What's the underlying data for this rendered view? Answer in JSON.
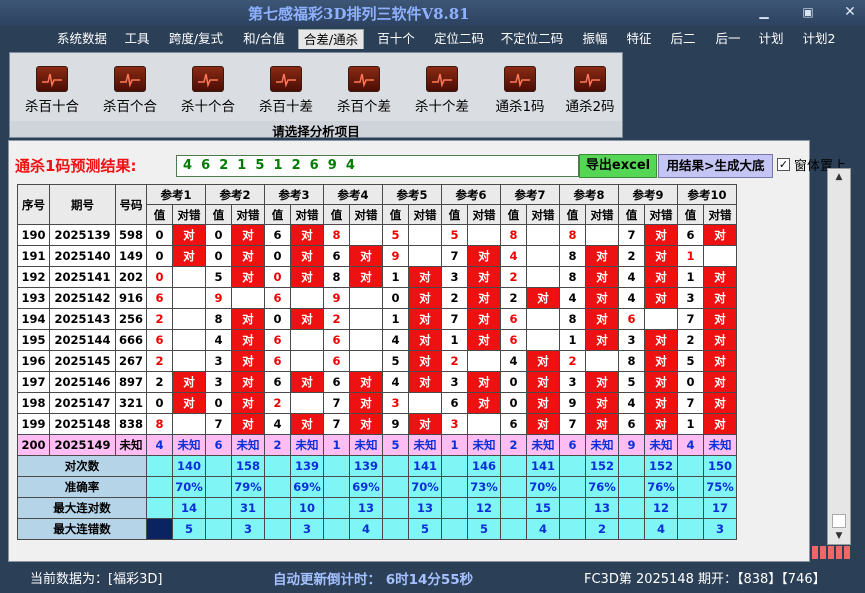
{
  "app": {
    "title": "第七感福彩3D排列三软件V8.81"
  },
  "menu": [
    "系统数据",
    "工具",
    "跨度/复式",
    "和/合值",
    "合差/通杀",
    "百十个",
    "定位二码",
    "不定位二码",
    "振幅",
    "特征",
    "后二",
    "后一",
    "计划",
    "计划2"
  ],
  "ribbon": {
    "items": [
      "杀百十合",
      "杀百个合",
      "杀十个合",
      "杀百十差",
      "杀百个差",
      "杀十个差",
      "通杀1码",
      "通杀2码"
    ],
    "caption": "请选择分析项目"
  },
  "prediction": {
    "label": "通杀1码预测结果:",
    "digits": "4  6  2  1  5  1  2  6  9  4",
    "export_button": "导出excel",
    "dadi_button": "用结果>生成大底",
    "topmost_label": "窗体置上",
    "topmost_checked": "✓"
  },
  "table": {
    "headers": {
      "index": "序号",
      "issue": "期号",
      "number": "号码",
      "value": "值",
      "result": "对错"
    },
    "refs": [
      "参考1",
      "参考2",
      "参考3",
      "参考4",
      "参考5",
      "参考6",
      "参考7",
      "参考8",
      "参考9",
      "参考10"
    ],
    "mark_symbol": "对",
    "rows": [
      {
        "idx": "190",
        "issue": "2025139",
        "num": "598",
        "vals": [
          "0",
          "0",
          "6",
          "8",
          "5",
          "5",
          "8",
          "8",
          "7",
          "6"
        ],
        "hits": [
          1,
          1,
          1,
          0,
          0,
          0,
          0,
          0,
          1,
          1
        ]
      },
      {
        "idx": "191",
        "issue": "2025140",
        "num": "149",
        "vals": [
          "0",
          "0",
          "0",
          "6",
          "9",
          "7",
          "4",
          "8",
          "2",
          "1"
        ],
        "hits": [
          1,
          1,
          1,
          1,
          0,
          1,
          0,
          1,
          1,
          0
        ]
      },
      {
        "idx": "192",
        "issue": "2025141",
        "num": "202",
        "vals": [
          "0",
          "5",
          "0",
          "8",
          "1",
          "3",
          "2",
          "8",
          "4",
          "1"
        ],
        "hits": [
          0,
          1,
          1,
          1,
          1,
          1,
          0,
          1,
          1,
          1
        ]
      },
      {
        "idx": "193",
        "issue": "2025142",
        "num": "916",
        "vals": [
          "6",
          "9",
          "6",
          "9",
          "0",
          "2",
          "2",
          "4",
          "4",
          "3"
        ],
        "hits": [
          0,
          0,
          0,
          0,
          1,
          1,
          1,
          1,
          1,
          1
        ]
      },
      {
        "idx": "194",
        "issue": "2025143",
        "num": "256",
        "vals": [
          "2",
          "8",
          "0",
          "2",
          "1",
          "7",
          "6",
          "8",
          "6",
          "7"
        ],
        "hits": [
          0,
          1,
          1,
          0,
          1,
          1,
          0,
          1,
          0,
          1
        ]
      },
      {
        "idx": "195",
        "issue": "2025144",
        "num": "666",
        "vals": [
          "6",
          "4",
          "6",
          "6",
          "4",
          "1",
          "6",
          "1",
          "3",
          "2"
        ],
        "hits": [
          0,
          1,
          0,
          0,
          1,
          1,
          0,
          1,
          1,
          1
        ]
      },
      {
        "idx": "196",
        "issue": "2025145",
        "num": "267",
        "vals": [
          "2",
          "3",
          "6",
          "6",
          "5",
          "2",
          "4",
          "2",
          "8",
          "5"
        ],
        "hits": [
          0,
          1,
          0,
          0,
          1,
          0,
          1,
          0,
          1,
          1
        ]
      },
      {
        "idx": "197",
        "issue": "2025146",
        "num": "897",
        "vals": [
          "2",
          "3",
          "6",
          "6",
          "4",
          "3",
          "0",
          "3",
          "5",
          "0"
        ],
        "hits": [
          1,
          1,
          1,
          1,
          1,
          1,
          1,
          1,
          1,
          1
        ]
      },
      {
        "idx": "198",
        "issue": "2025147",
        "num": "321",
        "vals": [
          "0",
          "0",
          "2",
          "7",
          "3",
          "6",
          "0",
          "9",
          "4",
          "7"
        ],
        "hits": [
          1,
          1,
          0,
          1,
          0,
          1,
          1,
          1,
          1,
          1
        ]
      },
      {
        "idx": "199",
        "issue": "2025148",
        "num": "838",
        "vals": [
          "8",
          "7",
          "4",
          "7",
          "9",
          "3",
          "6",
          "7",
          "6",
          "1"
        ],
        "hits": [
          0,
          1,
          1,
          1,
          1,
          0,
          1,
          1,
          1,
          1
        ]
      }
    ],
    "current": {
      "idx": "200",
      "issue": "2025149",
      "num": "未知",
      "vals": [
        "4",
        "6",
        "2",
        "1",
        "5",
        "1",
        "2",
        "6",
        "9",
        "4"
      ],
      "result": "未知"
    },
    "stats": [
      {
        "label": "对次数",
        "vals": [
          "140",
          "158",
          "139",
          "139",
          "141",
          "146",
          "141",
          "152",
          "152",
          "150"
        ]
      },
      {
        "label": "准确率",
        "vals": [
          "70%",
          "79%",
          "69%",
          "69%",
          "70%",
          "73%",
          "70%",
          "76%",
          "76%",
          "75%"
        ]
      },
      {
        "label": "最大连对数",
        "vals": [
          "14",
          "31",
          "10",
          "13",
          "13",
          "12",
          "15",
          "13",
          "12",
          "17"
        ]
      },
      {
        "label": "最大连错数",
        "vals": [
          "5",
          "3",
          "3",
          "4",
          "5",
          "5",
          "4",
          "2",
          "4",
          "3"
        ]
      }
    ]
  },
  "status": {
    "current_data": "当前数据为：[福彩3D]",
    "countdown": "自动更新倒计时：  6时14分55秒",
    "issue_info": "FC3D第 2025148 期开：【838】【746】"
  },
  "colors": {
    "hit": "#ee1111",
    "current_row": "#ffbdf3",
    "stats_row": "#7ff5f5",
    "value_blue": "#0a2fd8",
    "title_blue": "#8fb0ff"
  }
}
